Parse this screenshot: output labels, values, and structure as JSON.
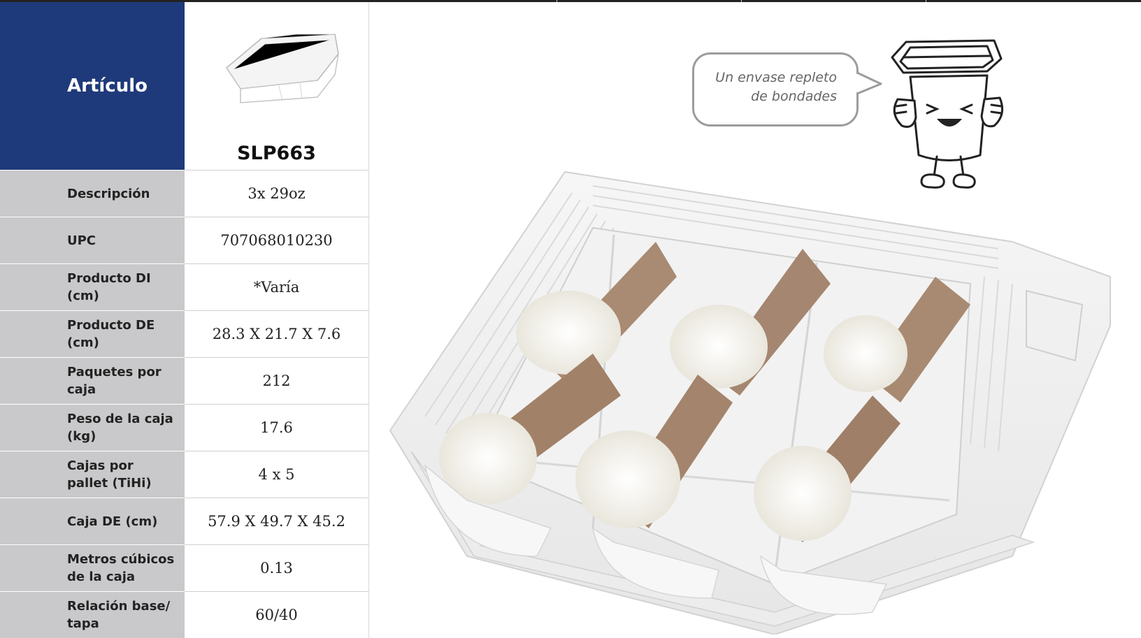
{
  "header": {
    "label": "Artículo",
    "sku": "SLP663"
  },
  "specs": [
    {
      "label": "Descripción",
      "value": "3x 29oz"
    },
    {
      "label": "UPC",
      "value": "707068010230"
    },
    {
      "label": "Producto DI (cm)",
      "value": "*Varía"
    },
    {
      "label": "Producto DE (cm)",
      "value": "28.3 X 21.7 X 7.6"
    },
    {
      "label": "Paquetes por caja",
      "value": "212"
    },
    {
      "label": "Peso de la caja (kg)",
      "value": "17.6"
    },
    {
      "label": "Cajas por pallet (TiHi)",
      "value": "4 x 5"
    },
    {
      "label": "Caja DE (cm)",
      "value": "57.9 X 49.7 X 45.2"
    },
    {
      "label": "Metros cúbicos de la caja",
      "value": "0.13"
    },
    {
      "label": "Relación base/ tapa",
      "value": "60/40"
    }
  ],
  "bubble": {
    "line1": "Un envase repleto",
    "line2": "de bondades"
  },
  "colors": {
    "header_bg": "#1f3a7a",
    "label_bg": "#c9c9cb"
  }
}
